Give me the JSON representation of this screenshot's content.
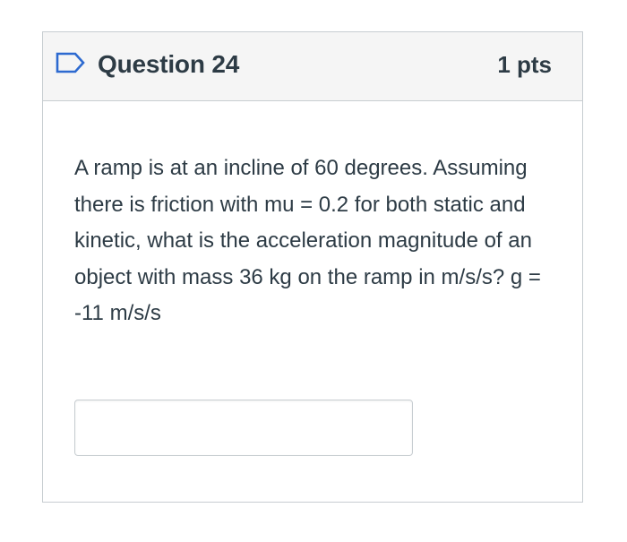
{
  "question": {
    "title": "Question 24",
    "points": "1 pts",
    "text": "A ramp is at an incline of 60 degrees. Assuming there is friction with mu = 0.2 for both static and kinetic, what is the acceleration magnitude of an object with mass 36 kg on the ramp in m/s/s?  g = -11 m/s/s",
    "flag_icon": "bookmark-flag-icon"
  },
  "answer": {
    "value": "",
    "placeholder": ""
  },
  "colors": {
    "header_bg": "#f5f5f5",
    "border": "#c7cdd1",
    "text": "#2d3b45",
    "flag_stroke": "#2d6ad0"
  }
}
